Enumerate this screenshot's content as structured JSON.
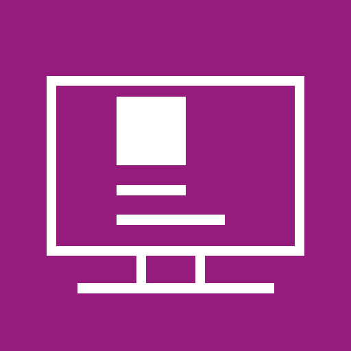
{
  "icon": {
    "name": "desktop-monitor-icon",
    "background_color": "#951b7d",
    "foreground_color": "#ffffff"
  }
}
